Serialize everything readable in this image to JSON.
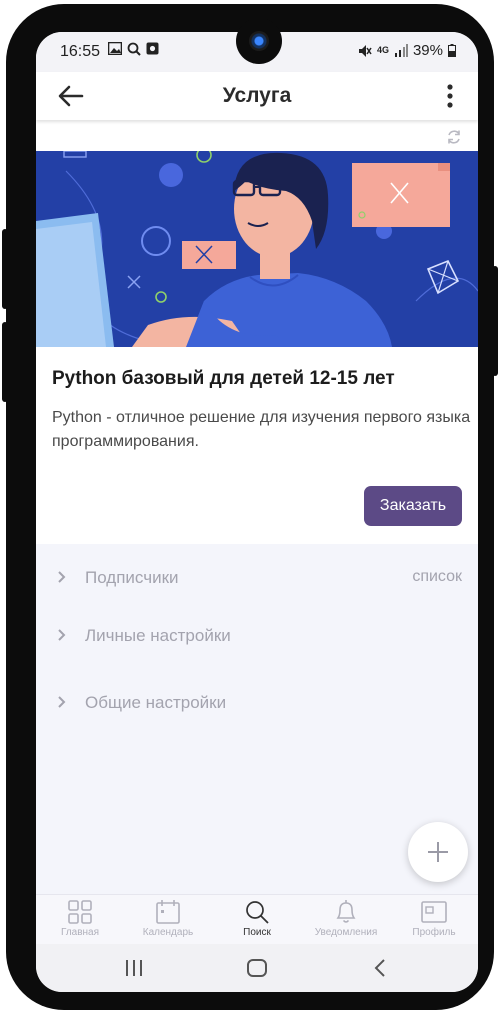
{
  "status_bar": {
    "time": "16:55",
    "network": "4G",
    "battery": "39%"
  },
  "app_bar": {
    "title": "Услуга",
    "back_icon": "arrow-left-icon",
    "menu_icon": "more-vertical-icon"
  },
  "service": {
    "title": "Python базовый для детей 12-15 лет",
    "description": "Python - отличное решение для изучения первого языка программирования.",
    "order_label": "Заказать",
    "banner_colors": {
      "background": "#2340a6",
      "accent": "#f5a89a",
      "shirt": "#3d62d6"
    }
  },
  "menu": {
    "items": [
      {
        "label": "Подписчики",
        "value": "список"
      },
      {
        "label": "Личные настройки"
      },
      {
        "label": "Общие настройки"
      }
    ]
  },
  "bottom_nav": {
    "items": [
      {
        "label": "Главная",
        "icon": "grid-icon"
      },
      {
        "label": "Календарь",
        "icon": "calendar-icon"
      },
      {
        "label": "Поиск",
        "icon": "search-icon",
        "active": true
      },
      {
        "label": "Уведомления",
        "icon": "bell-icon"
      },
      {
        "label": "Профиль",
        "icon": "profile-icon"
      }
    ]
  },
  "colors": {
    "primary_button": "#5c4a86",
    "content_background": "#f4f5fb"
  }
}
